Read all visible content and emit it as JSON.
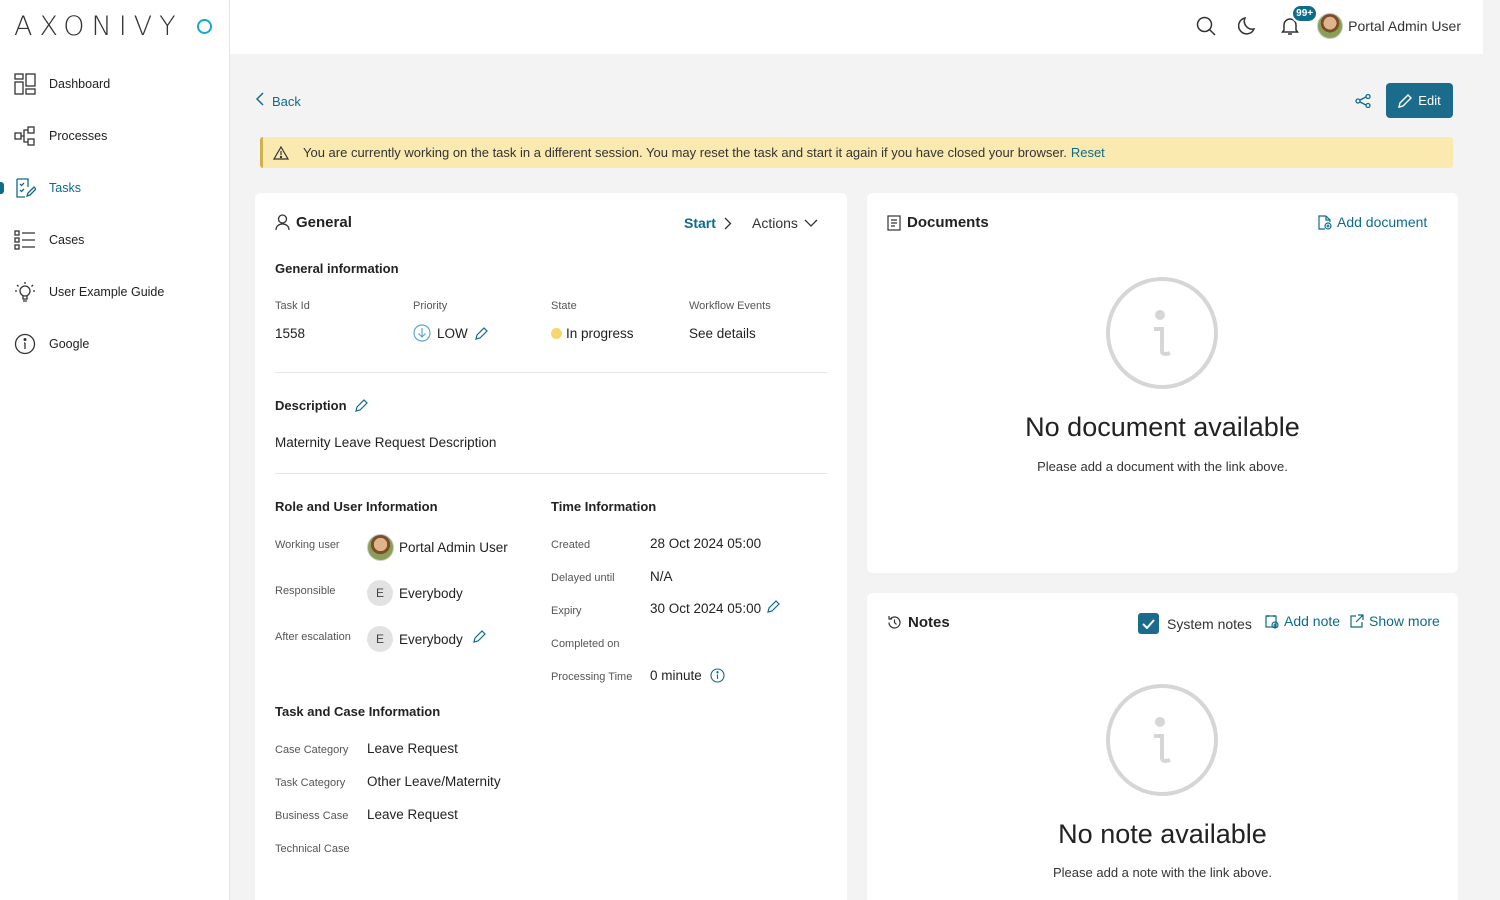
{
  "brand": {
    "logo_text": "AXONIVY"
  },
  "sidebar": {
    "items": [
      {
        "label": "Dashboard",
        "icon": "dashboard-icon"
      },
      {
        "label": "Processes",
        "icon": "processes-icon"
      },
      {
        "label": "Tasks",
        "icon": "tasks-icon",
        "active": true
      },
      {
        "label": "Cases",
        "icon": "cases-icon"
      },
      {
        "label": "User Example Guide",
        "icon": "lightbulb-icon"
      },
      {
        "label": "Google",
        "icon": "info-icon"
      }
    ]
  },
  "topbar": {
    "notification_badge": "99+",
    "user_name": "Portal Admin User"
  },
  "toolbar": {
    "back_label": "Back",
    "edit_label": "Edit"
  },
  "warning": {
    "message": "You are currently working on the task in a different session. You may reset the task and start it again if you have closed your browser.",
    "reset_label": "Reset"
  },
  "general": {
    "title": "General",
    "start_label": "Start",
    "actions_label": "Actions",
    "info_heading": "General information",
    "task_id_label": "Task Id",
    "task_id": "1558",
    "priority_label": "Priority",
    "priority": "LOW",
    "state_label": "State",
    "state": "In progress",
    "workflow_label": "Workflow Events",
    "workflow_link": "See details",
    "description_heading": "Description",
    "description": "Maternity Leave Request Description",
    "role_heading": "Role and User Information",
    "working_user_label": "Working user",
    "working_user": "Portal Admin User",
    "responsible_label": "Responsible",
    "responsible": "Everybody",
    "responsible_initial": "E",
    "after_escalation_label": "After escalation",
    "after_escalation": "Everybody",
    "after_escalation_initial": "E",
    "time_heading": "Time Information",
    "created_label": "Created",
    "created": "28 Oct 2024 05:00",
    "delayed_label": "Delayed until",
    "delayed": "N/A",
    "expiry_label": "Expiry",
    "expiry": "30 Oct 2024 05:00",
    "completed_label": "Completed on",
    "processing_label": "Processing Time",
    "processing": "0 minute",
    "taskcase_heading": "Task and Case Information",
    "case_category_label": "Case Category",
    "case_category": "Leave Request",
    "task_category_label": "Task Category",
    "task_category": "Other Leave/Maternity",
    "business_case_label": "Business Case",
    "business_case": "Leave Request",
    "technical_case_label": "Technical Case"
  },
  "documents": {
    "title": "Documents",
    "add_label": "Add document",
    "empty_title": "No document available",
    "empty_sub": "Please add a document with the link above."
  },
  "notes": {
    "title": "Notes",
    "system_notes_label": "System notes",
    "system_notes_checked": true,
    "add_label": "Add note",
    "show_more_label": "Show more",
    "empty_title": "No note available",
    "empty_sub": "Please add a note with the link above."
  },
  "colors": {
    "accent": "#0d6b8c",
    "warning_bg": "#fbeab0",
    "state_dot": "#f5d76e"
  }
}
